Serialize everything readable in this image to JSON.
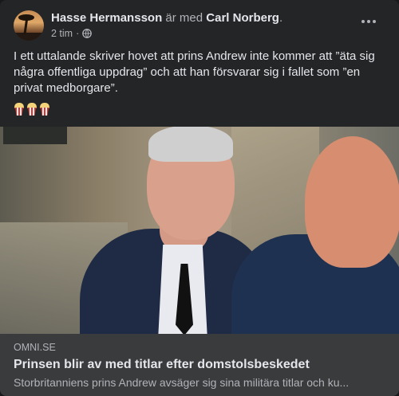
{
  "post": {
    "author": "Hasse Hermansson",
    "with_text": " är med ",
    "tagged": "Carl Norberg",
    "tagged_suffix": ".",
    "time": "2 tim",
    "dot": " · ",
    "privacy_icon": "globe-icon",
    "text": "I ett uttalande skriver hovet att prins Andrew inte kommer att ”äta sig några offentliga uppdrag” och att han försvarar sig i fallet som ”en privat medborgare”.",
    "emojis": [
      "popcorn-icon",
      "popcorn-icon",
      "popcorn-icon"
    ]
  },
  "link": {
    "domain": "OMNI.SE",
    "title": "Prinsen blir av med titlar efter domstolsbeskedet",
    "description": "Storbritanniens prins Andrew avsäger sig sina militära titlar och ku..."
  },
  "colors": {
    "card_bg": "#242526",
    "link_bg": "#3a3b3c",
    "text_primary": "#e4e6eb",
    "text_secondary": "#b0b3b8"
  }
}
